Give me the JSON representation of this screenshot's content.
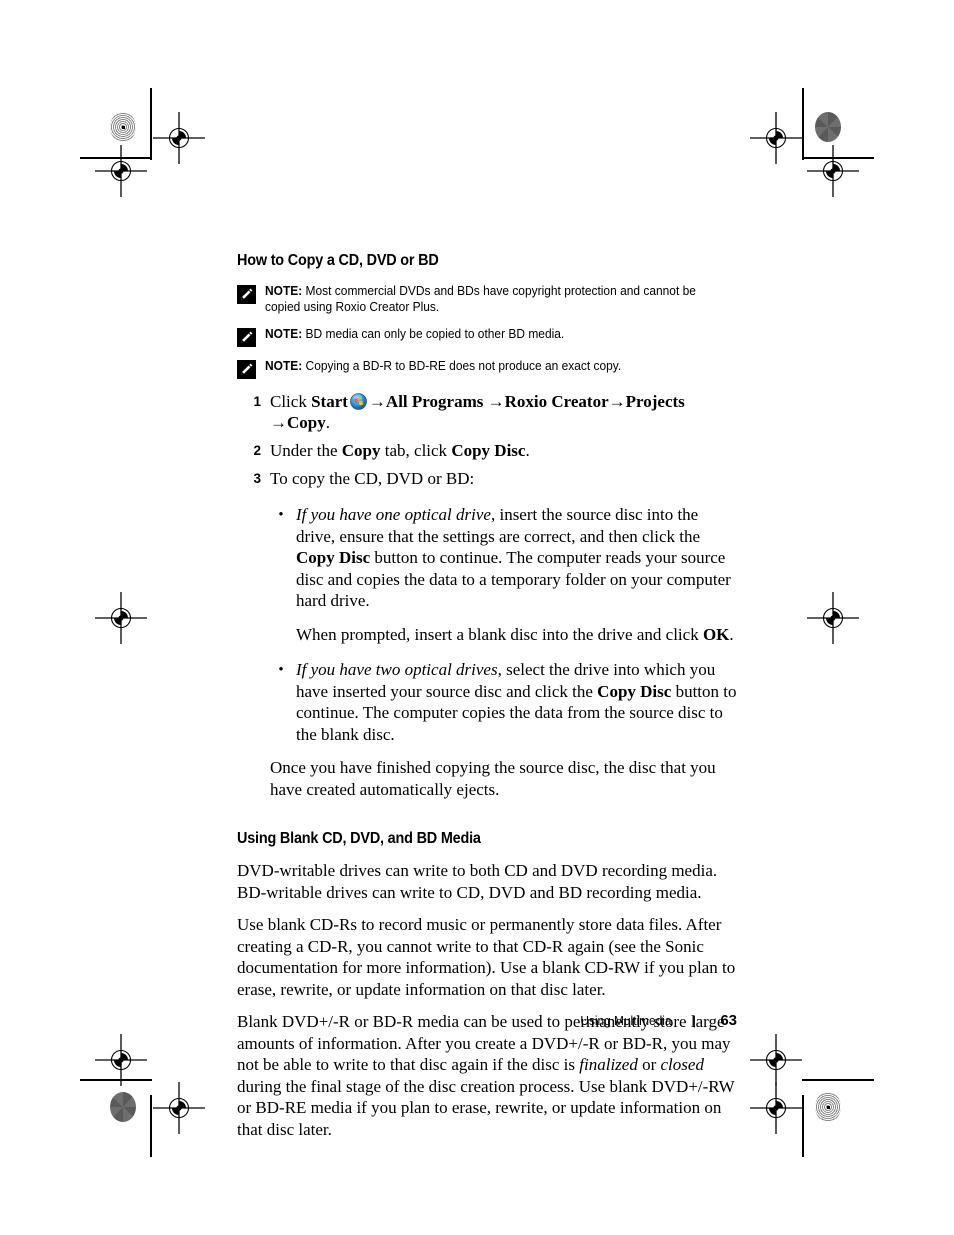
{
  "document": {
    "section_heading_1": "How to Copy a CD, DVD or BD",
    "section_heading_2": "Using Blank CD, DVD, and BD Media",
    "notes": [
      {
        "label": "NOTE:",
        "text": "Most commercial DVDs and BDs have copyright protection and cannot be copied using Roxio Creator Plus."
      },
      {
        "label": "NOTE:",
        "text": "BD media can only be copied to other BD media."
      },
      {
        "label": "NOTE:",
        "text": "Copying a BD-R to BD-RE does not produce an exact copy."
      }
    ],
    "steps": [
      {
        "num": "1",
        "prefix": "Click ",
        "start_label": "Start",
        "arrow": "→",
        "path_items": [
          "All Programs",
          "Roxio Creator",
          "Projects",
          "Copy"
        ],
        "suffix": "."
      },
      {
        "num": "2",
        "text_before": "Under the ",
        "bold_1": "Copy",
        "text_middle": " tab, click ",
        "bold_2": "Copy Disc",
        "text_after": "."
      },
      {
        "num": "3",
        "text": "To copy the CD, DVD or BD:"
      }
    ],
    "bullets": [
      {
        "marker": "•",
        "italic": "If you have one optical drive",
        "text_1": ", insert the source disc into the drive, ensure that the settings are correct, and then click the ",
        "bold": "Copy Disc",
        "text_2": " button to continue. The computer reads your source disc and copies the data to a temporary folder on your computer hard drive."
      },
      {
        "marker": "•",
        "italic": "If you have two optical drives",
        "text_1": ", select the drive into which you have inserted your source disc and click the ",
        "bold": "Copy Disc",
        "text_2": " button to continue. The computer copies the data from the source disc to the blank disc."
      }
    ],
    "prompt_paragraph": {
      "text_1": "When prompted, insert a blank disc into the drive and click ",
      "bold": "OK",
      "text_2": "."
    },
    "closing_paragraph": "Once you have finished copying the source disc, the disc that you have created automatically ejects.",
    "body_paragraphs": [
      "DVD-writable drives can write to both CD and DVD recording media. BD-writable drives can write to CD, DVD and BD recording media.",
      "Use blank CD-Rs to record music or permanently store data files. After creating a CD-R, you cannot write to that CD-R again (see the Sonic documentation for more information). Use a blank CD-RW if you plan to erase, rewrite, or update information on that disc later."
    ],
    "final_paragraph": {
      "text_1": "Blank DVD+/-R or BD-R media can be used to permanently store large amounts of information. After you create a DVD+/-R or BD-R, you may not be able to write to that disc again if the disc is ",
      "italic_1": "finalized",
      "text_2": " or ",
      "italic_2": "closed",
      "text_3": " during the final stage of the disc creation process. Use blank DVD+/-RW or BD-RE media if you plan to erase, rewrite, or update information on that disc later."
    }
  },
  "footer": {
    "title": "Using Multimedia",
    "separator": "|",
    "page_number": "63"
  },
  "icons": {
    "note_icon": "pencil-note-icon",
    "windows_start_orb": "windows-start-orb-icon",
    "registration_mark": "registration-target-icon",
    "halftone_patch": "halftone-density-patch"
  },
  "colors": {
    "text": "#000000",
    "background": "#ffffff",
    "orb_blue": "#1a6fc4",
    "flag_red": "#e8533a",
    "flag_green": "#78c043",
    "flag_blue": "#3aa6e8",
    "flag_yellow": "#f4c430"
  }
}
